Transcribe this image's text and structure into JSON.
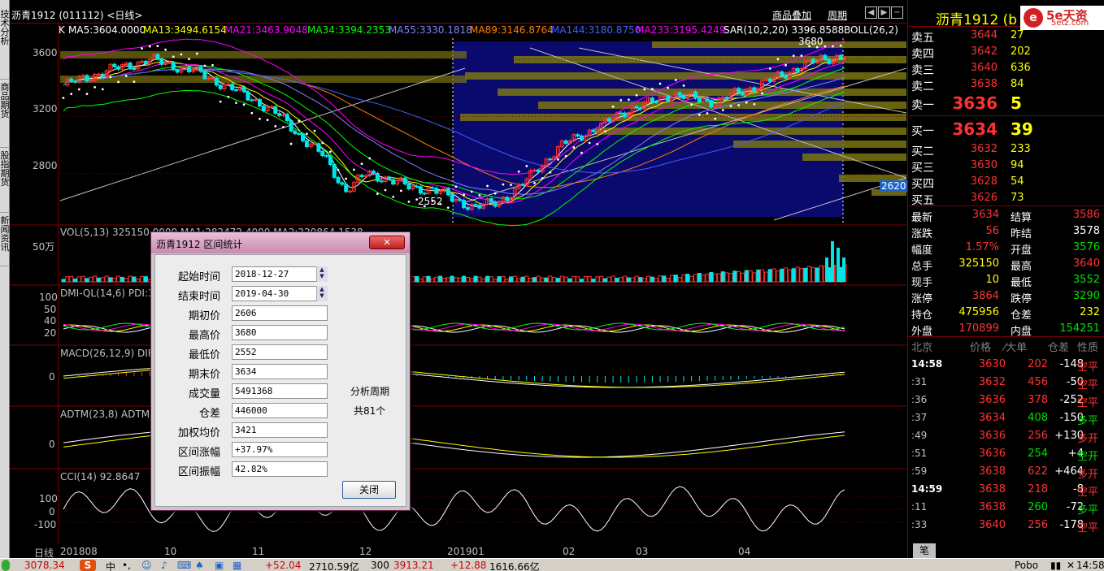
{
  "title_bar": {
    "chart_title": "沥青1912 (011112) <日线>",
    "link_overlay": "商品叠加",
    "link_period": "周期"
  },
  "left_tabs": [
    "技术分析",
    "商品期货",
    "股指期货",
    "新闻资讯"
  ],
  "indicators": {
    "ma_row": [
      {
        "text": "K",
        "color": "#ffffff"
      },
      {
        "text": "MA5:3604.0000",
        "color": "#ffffff"
      },
      {
        "text": "MA13:3494.6154",
        "color": "#ffff00"
      },
      {
        "text": "MA21:3463.9048",
        "color": "#ff00ff"
      },
      {
        "text": "MA34:3394.2353",
        "color": "#00ff00"
      },
      {
        "text": "MA55:3330.1818",
        "color": "#8080ff"
      },
      {
        "text": "MA89:3146.8764",
        "color": "#ff8000"
      },
      {
        "text": "MA144:3180.8750",
        "color": "#4060ff"
      },
      {
        "text": "MA233:3195.4249",
        "color": "#ff00ff"
      },
      {
        "text": "SAR(10,2,20)  3396.8588",
        "color": "#ffffff"
      },
      {
        "text": "BOLL(26,2)",
        "color": "#ffffff"
      }
    ],
    "vol_row": "VOL(5,13)  325150.0000  MA1:282472.4000  MA2:220864.1538",
    "dmi_row": "DMI-QL(14,6) PDI:3",
    "macd_row": "MACD(26,12,9) DIF",
    "adtm_row": "ADTM(23,8) ADTM:",
    "cci_row": "CCI(14)  92.8647"
  },
  "axis": {
    "price_ticks": [
      "3600",
      "3200",
      "2800"
    ],
    "vol_tick": "50万",
    "dmi_ticks": [
      "100",
      "50",
      "40",
      "20"
    ],
    "macd_tick": "0",
    "adtm_tick": "0",
    "cci_ticks": [
      "100",
      "0",
      "-100"
    ],
    "date_labels": [
      "日线",
      "201808",
      "10",
      "11",
      "12",
      "201901",
      "02",
      "03",
      "04"
    ],
    "price_marks": {
      "high": "3680",
      "low": "2552",
      "current_tag": "2620"
    }
  },
  "chart_data": {
    "type": "candlestick",
    "title": "沥青1912 (011112) <日线>",
    "x_start": "2018-08",
    "x_end": "2019-04-30",
    "ylim": [
      2450,
      3750
    ],
    "key_points": {
      "period_high": 3680,
      "period_low": 2552,
      "last_close": 3634
    },
    "selection_range": {
      "start": "2018-12-27",
      "end": "2019-04-30"
    },
    "price_levels_shown": [
      3600,
      3200,
      2800
    ],
    "close_path_approx": [
      3420,
      3470,
      3520,
      3560,
      3600,
      3560,
      3520,
      3450,
      3380,
      3300,
      3200,
      3050,
      2920,
      2680,
      2800,
      2760,
      2700,
      2690,
      2620,
      2560,
      2600,
      2700,
      2860,
      3000,
      3080,
      3150,
      3250,
      3290,
      3360,
      3330,
      3300,
      3360,
      3420,
      3480,
      3560,
      3600,
      3634
    ]
  },
  "right_panel": {
    "symbol": "沥青1912 (b",
    "logo_text": "5e天资",
    "logo_sub": "5etz.com",
    "sell": [
      {
        "label": "卖五",
        "price": "3644",
        "vol": "27"
      },
      {
        "label": "卖四",
        "price": "3642",
        "vol": "202"
      },
      {
        "label": "卖三",
        "price": "3640",
        "vol": "636"
      },
      {
        "label": "卖二",
        "price": "3638",
        "vol": "84"
      },
      {
        "label": "卖一",
        "price": "3636",
        "vol": "5"
      }
    ],
    "buy": [
      {
        "label": "买一",
        "price": "3634",
        "vol": "39"
      },
      {
        "label": "买二",
        "price": "3632",
        "vol": "233"
      },
      {
        "label": "买三",
        "price": "3630",
        "vol": "94"
      },
      {
        "label": "买四",
        "price": "3628",
        "vol": "54"
      },
      {
        "label": "买五",
        "price": "3626",
        "vol": "73"
      }
    ],
    "stats": [
      {
        "l1": "最新",
        "v1": "3634",
        "c1": "#ff3232",
        "l2": "结算",
        "v2": "3586",
        "c2": "#ff3232"
      },
      {
        "l1": "涨跌",
        "v1": "56",
        "c1": "#ff3232",
        "l2": "昨结",
        "v2": "3578",
        "c2": "#ffffff"
      },
      {
        "l1": "幅度",
        "v1": "1.57%",
        "c1": "#ff3232",
        "l2": "开盘",
        "v2": "3576",
        "c2": "#00e000"
      },
      {
        "l1": "总手",
        "v1": "325150",
        "c1": "#ffff00",
        "l2": "最高",
        "v2": "3640",
        "c2": "#ff3232"
      },
      {
        "l1": "现手",
        "v1": "10",
        "c1": "#ffff00",
        "l2": "最低",
        "v2": "3552",
        "c2": "#00e000"
      },
      {
        "l1": "涨停",
        "v1": "3864",
        "c1": "#ff3232",
        "l2": "跌停",
        "v2": "3290",
        "c2": "#00e000"
      },
      {
        "l1": "持仓",
        "v1": "475956",
        "c1": "#ffff00",
        "l2": "仓差",
        "v2": "232",
        "c2": "#ffff00"
      },
      {
        "l1": "外盘",
        "v1": "170899",
        "c1": "#ff3232",
        "l2": "内盘",
        "v2": "154251",
        "c2": "#00e000"
      }
    ],
    "tick_header": {
      "region": "北京",
      "price": "价格",
      "vol": "⁄大单",
      "oi": "仓差",
      "nature": "性质"
    },
    "ticks": [
      {
        "time": "14:58",
        "price": "3630",
        "vol": "202",
        "chg": "-148",
        "chg_color": "#ffffff",
        "nature": "空平",
        "nat_color": "#ff3232"
      },
      {
        "time": ":31",
        "price": "3632",
        "vol": "456",
        "chg": "-50",
        "chg_color": "#ffffff",
        "nature": "空平",
        "nat_color": "#ff3232"
      },
      {
        "time": ":36",
        "price": "3636",
        "vol": "378",
        "chg": "-252",
        "chg_color": "#ffffff",
        "nature": "空平",
        "nat_color": "#ff3232"
      },
      {
        "time": ":37",
        "price": "3634",
        "vol": "408",
        "vol_color": "#00e000",
        "chg": "-150",
        "chg_color": "#ffffff",
        "nature": "多平",
        "nat_color": "#00e000"
      },
      {
        "time": ":49",
        "price": "3636",
        "vol": "256",
        "chg": "+130",
        "chg_color": "#ffffff",
        "nature": "多开",
        "nat_color": "#ff3232"
      },
      {
        "time": ":51",
        "price": "3636",
        "vol": "254",
        "vol_color": "#00e000",
        "chg": "+4",
        "chg_color": "#ffffff",
        "nature": "空开",
        "nat_color": "#00e000"
      },
      {
        "time": ":59",
        "price": "3638",
        "vol": "622",
        "chg": "+464",
        "chg_color": "#ffffff",
        "nature": "多开",
        "nat_color": "#ff3232"
      },
      {
        "time": "14:59",
        "price": "3638",
        "vol": "218",
        "chg": "-8",
        "chg_color": "#ffffff",
        "nature": "空平",
        "nat_color": "#ff3232"
      },
      {
        "time": ":11",
        "price": "3638",
        "vol": "260",
        "vol_color": "#00e000",
        "chg": "-72",
        "chg_color": "#ffffff",
        "nature": "多平",
        "nat_color": "#00e000"
      },
      {
        "time": ":33",
        "price": "3640",
        "vol": "256",
        "chg": "-178",
        "chg_color": "#ffffff",
        "nature": "空平",
        "nat_color": "#ff3232"
      }
    ],
    "bottom_tab": "笔"
  },
  "status_bar": {
    "idx1_price": "3078.34",
    "idx2_chg": "+52.04",
    "idx2_amt": "2710.59亿",
    "idx3_code": "300",
    "idx3_price": "3913.21",
    "idx3_chg": "+12.88",
    "idx3_amt": "1616.66亿",
    "ime": "中",
    "right_text": "Pobo",
    "clock": "14:58"
  },
  "dialog": {
    "title": "沥青1912 区间统计",
    "close_label": "关闭",
    "ok_label": "关闭",
    "fields": [
      {
        "label": "起始时间",
        "value": "2018-12-27",
        "spin": true
      },
      {
        "label": "结束时间",
        "value": "2019-04-30",
        "spin": true
      },
      {
        "label": "期初价",
        "value": "2606"
      },
      {
        "label": "最高价",
        "value": "3680"
      },
      {
        "label": "最低价",
        "value": "2552"
      },
      {
        "label": "期末价",
        "value": "3634"
      },
      {
        "label": "成交量",
        "value": "5491368"
      },
      {
        "label": "仓差",
        "value": "446000"
      },
      {
        "label": "加权均价",
        "value": "3421"
      },
      {
        "label": "区间涨幅",
        "value": "+37.97%"
      },
      {
        "label": "区间振幅",
        "value": "42.82%"
      }
    ],
    "side_label_1": "分析周期",
    "side_label_2": "共81个"
  }
}
